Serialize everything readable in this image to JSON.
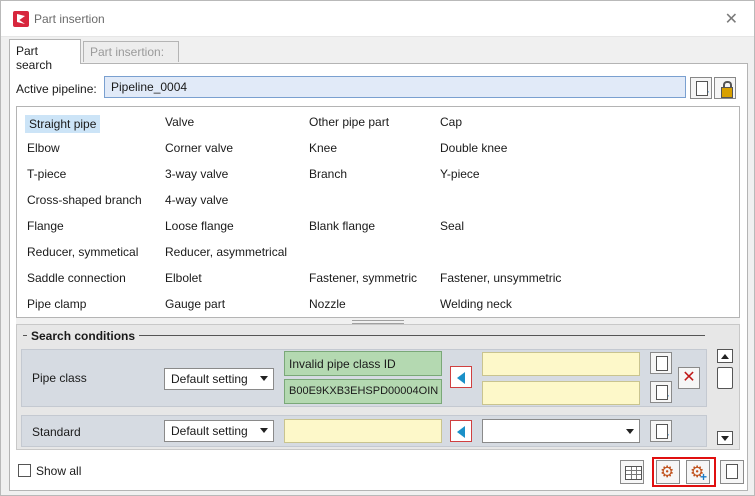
{
  "window": {
    "title": "Part insertion",
    "close": "✕"
  },
  "tabs": [
    {
      "label": "Part search",
      "active": true
    },
    {
      "label": "Part insertion:",
      "active": false
    }
  ],
  "active_pipeline": {
    "label": "Active pipeline:",
    "value": "Pipeline_0004"
  },
  "parts": [
    {
      "label": "Straight pipe",
      "selected": true
    },
    {
      "label": "Valve"
    },
    {
      "label": "Other pipe part"
    },
    {
      "label": "Cap"
    },
    {
      "label": "Elbow"
    },
    {
      "label": "Corner valve"
    },
    {
      "label": "Knee"
    },
    {
      "label": "Double knee"
    },
    {
      "label": "T-piece"
    },
    {
      "label": "3-way valve"
    },
    {
      "label": "Branch"
    },
    {
      "label": "Y-piece"
    },
    {
      "label": "Cross-shaped branch"
    },
    {
      "label": "4-way valve"
    },
    {
      "label": "Flange"
    },
    {
      "label": "Loose flange"
    },
    {
      "label": "Blank flange"
    },
    {
      "label": "Seal"
    },
    {
      "label": "Reducer, symmetical"
    },
    {
      "label": "Reducer, asymmetrical"
    },
    {
      "label": "Saddle connection"
    },
    {
      "label": "Elbolet"
    },
    {
      "label": "Fastener, symmetric"
    },
    {
      "label": "Fastener, unsymmetric"
    },
    {
      "label": "Pipe clamp"
    },
    {
      "label": "Gauge part"
    },
    {
      "label": "Nozzle"
    },
    {
      "label": "Welding neck"
    }
  ],
  "search_conditions": {
    "title": "Search conditions",
    "pipe_class": {
      "label": "Pipe class",
      "setting": "Default setting",
      "status": "Invalid pipe class ID",
      "id": "B00E9KXB3EHSPD00004OIN"
    },
    "standard": {
      "label": "Standard",
      "setting": "Default setting"
    }
  },
  "show_all": {
    "label": "Show all",
    "checked": false
  },
  "colors": {
    "active_field": "#e1eaf8",
    "green_field": "#b4d9b1",
    "yellow_field": "#fdf8c9",
    "highlight_box": "#e01010",
    "selection": "#cce4f7"
  }
}
